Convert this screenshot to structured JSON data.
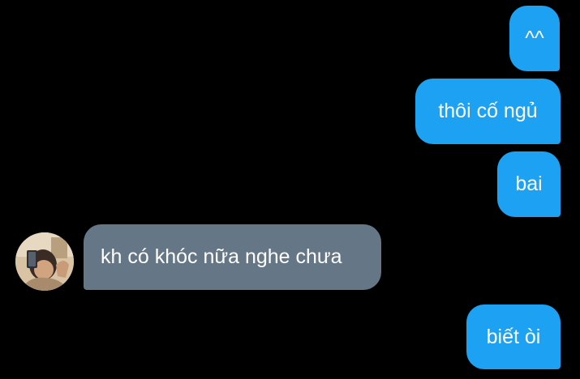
{
  "theme": {
    "background": "#000000",
    "outgoing_bubble_color": "#1da1f2",
    "incoming_bubble_color": "#657786",
    "text_color": "#ffffff"
  },
  "messages": [
    {
      "direction": "outgoing",
      "text": "^^"
    },
    {
      "direction": "outgoing",
      "text": "thôi cố ngủ"
    },
    {
      "direction": "outgoing",
      "text": "bai"
    },
    {
      "direction": "incoming",
      "text": "kh có khóc nữa nghe chưa",
      "sender_avatar": "user-avatar-photo"
    },
    {
      "direction": "outgoing",
      "text": "biết òi"
    }
  ]
}
